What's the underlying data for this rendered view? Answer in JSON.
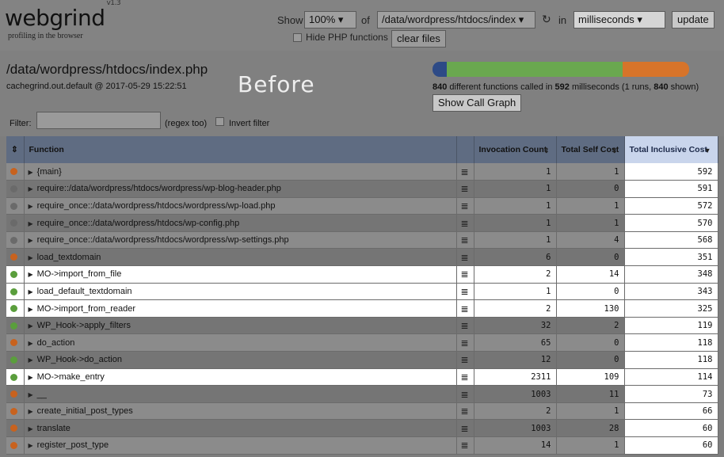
{
  "app": {
    "name": "webgrind",
    "version": "v1.3",
    "tagline": "profiling in the browser"
  },
  "toolbar": {
    "show_label": "Show",
    "percent": "100%",
    "of_label": "of",
    "file": "/data/wordpress/htdocs/index",
    "refresh_icon": "↻",
    "in_label": "in",
    "unit": "milliseconds",
    "update_label": "update",
    "hide_php_label": "Hide PHP functions",
    "clear_label": "clear files"
  },
  "header": {
    "path": "/data/wordpress/htdocs/index.php",
    "cachefile": "cachegrind.out.default @ 2017-05-29 15:22:51",
    "overlay": "Before",
    "summary_count": "840",
    "summary_text1": " different functions called in ",
    "summary_ms": "592",
    "summary_text2": " milliseconds (1 runs, ",
    "summary_shown": "840",
    "summary_text3": " shown)",
    "call_graph_label": "Show Call Graph",
    "bar_colors": [
      "#2d4a86",
      "#6aa84f",
      "#d7742a"
    ]
  },
  "filter": {
    "label": "Filter:",
    "hint": "(regex too)",
    "invert_label": "Invert filter"
  },
  "table": {
    "columns": [
      "Function",
      "Invocation Count",
      "Total Self Cost",
      "Total Inclusive Cost"
    ],
    "rows": [
      {
        "color": "#c8621e",
        "name": "{main}",
        "inv": "1",
        "self": "1",
        "incl": "592",
        "hl": false
      },
      {
        "color": "#6a6a6a",
        "name": "require::/data/wordpress/htdocs/wordpress/wp-blog-header.php",
        "inv": "1",
        "self": "0",
        "incl": "591",
        "hl": false
      },
      {
        "color": "#6a6a6a",
        "name": "require_once::/data/wordpress/htdocs/wordpress/wp-load.php",
        "inv": "1",
        "self": "1",
        "incl": "572",
        "hl": false
      },
      {
        "color": "#6a6a6a",
        "name": "require_once::/data/wordpress/htdocs/wp-config.php",
        "inv": "1",
        "self": "1",
        "incl": "570",
        "hl": false
      },
      {
        "color": "#6a6a6a",
        "name": "require_once::/data/wordpress/htdocs/wordpress/wp-settings.php",
        "inv": "1",
        "self": "4",
        "incl": "568",
        "hl": false
      },
      {
        "color": "#c8621e",
        "name": "load_textdomain",
        "inv": "6",
        "self": "0",
        "incl": "351",
        "hl": false
      },
      {
        "color": "#5a9e3c",
        "name": "MO->import_from_file",
        "inv": "2",
        "self": "14",
        "incl": "348",
        "hl": true
      },
      {
        "color": "#5a9e3c",
        "name": "load_default_textdomain",
        "inv": "1",
        "self": "0",
        "incl": "343",
        "hl": true
      },
      {
        "color": "#5a9e3c",
        "name": "MO->import_from_reader",
        "inv": "2",
        "self": "130",
        "incl": "325",
        "hl": true
      },
      {
        "color": "#5a9e3c",
        "name": "WP_Hook->apply_filters",
        "inv": "32",
        "self": "2",
        "incl": "119",
        "hl": false
      },
      {
        "color": "#c8621e",
        "name": "do_action",
        "inv": "65",
        "self": "0",
        "incl": "118",
        "hl": false
      },
      {
        "color": "#5a9e3c",
        "name": "WP_Hook->do_action",
        "inv": "12",
        "self": "0",
        "incl": "118",
        "hl": false
      },
      {
        "color": "#5a9e3c",
        "name": "MO->make_entry",
        "inv": "2311",
        "self": "109",
        "incl": "114",
        "hl": true
      },
      {
        "color": "#c8621e",
        "name": "__",
        "inv": "1003",
        "self": "11",
        "incl": "73",
        "hl": false
      },
      {
        "color": "#c8621e",
        "name": "create_initial_post_types",
        "inv": "2",
        "self": "1",
        "incl": "66",
        "hl": false
      },
      {
        "color": "#c8621e",
        "name": "translate",
        "inv": "1003",
        "self": "28",
        "incl": "60",
        "hl": false
      },
      {
        "color": "#c8621e",
        "name": "register_post_type",
        "inv": "14",
        "self": "1",
        "incl": "60",
        "hl": false
      }
    ]
  }
}
